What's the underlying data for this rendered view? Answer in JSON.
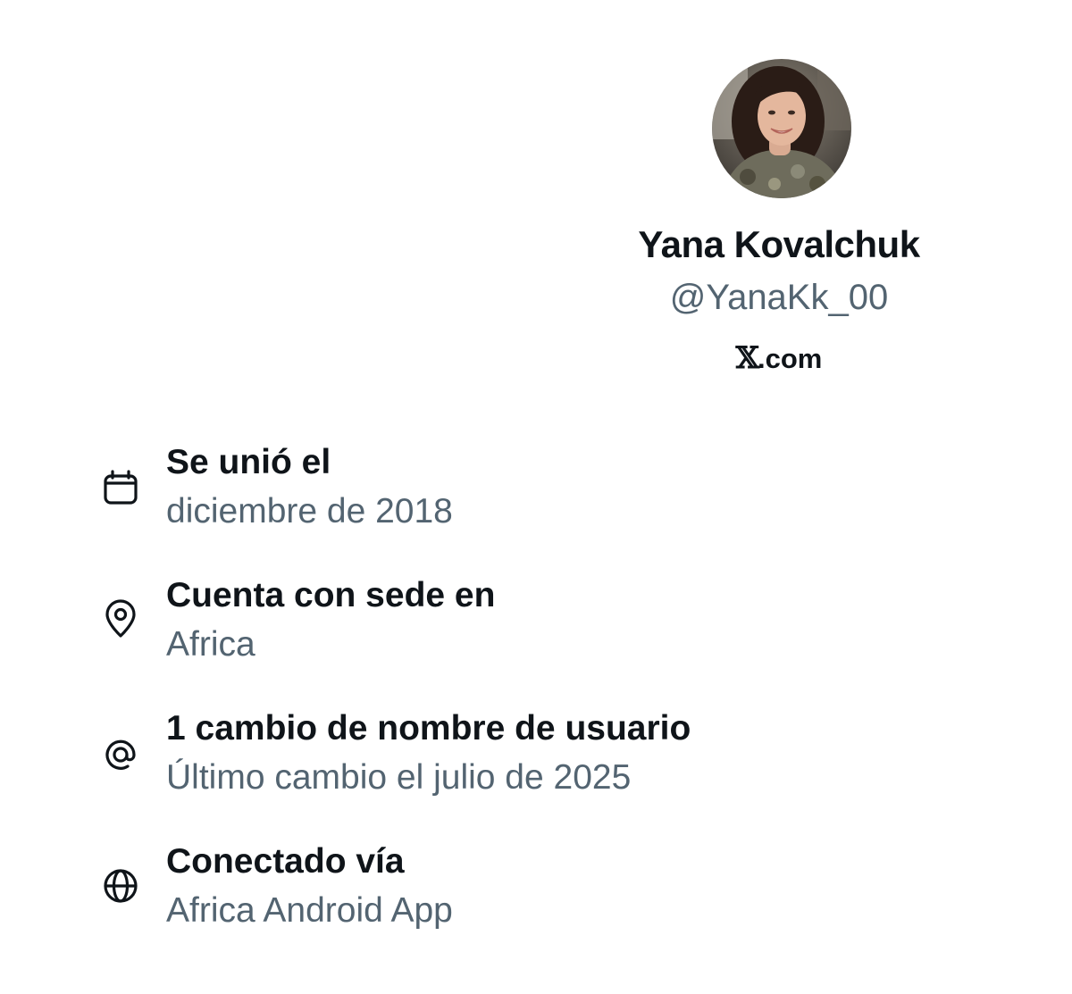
{
  "profile": {
    "avatar_icon": "user-avatar-photo",
    "display_name": "Yana Kovalchuk",
    "handle": "@YanaKk_00",
    "site": {
      "mark": "𝕏",
      "domain": ".com"
    }
  },
  "info": [
    {
      "icon": "calendar-icon",
      "title": "Se unió el",
      "value": "diciembre de 2018"
    },
    {
      "icon": "location-pin-icon",
      "title": "Cuenta con sede en",
      "value": "Africa"
    },
    {
      "icon": "at-sign-icon",
      "title": "1 cambio de nombre de usuario",
      "value": "Último cambio el julio de 2025"
    },
    {
      "icon": "globe-icon",
      "title": "Conectado vía",
      "value": "Africa Android App"
    }
  ],
  "colors": {
    "primary_text": "#0f1419",
    "secondary_text": "#536471",
    "background": "#ffffff"
  }
}
